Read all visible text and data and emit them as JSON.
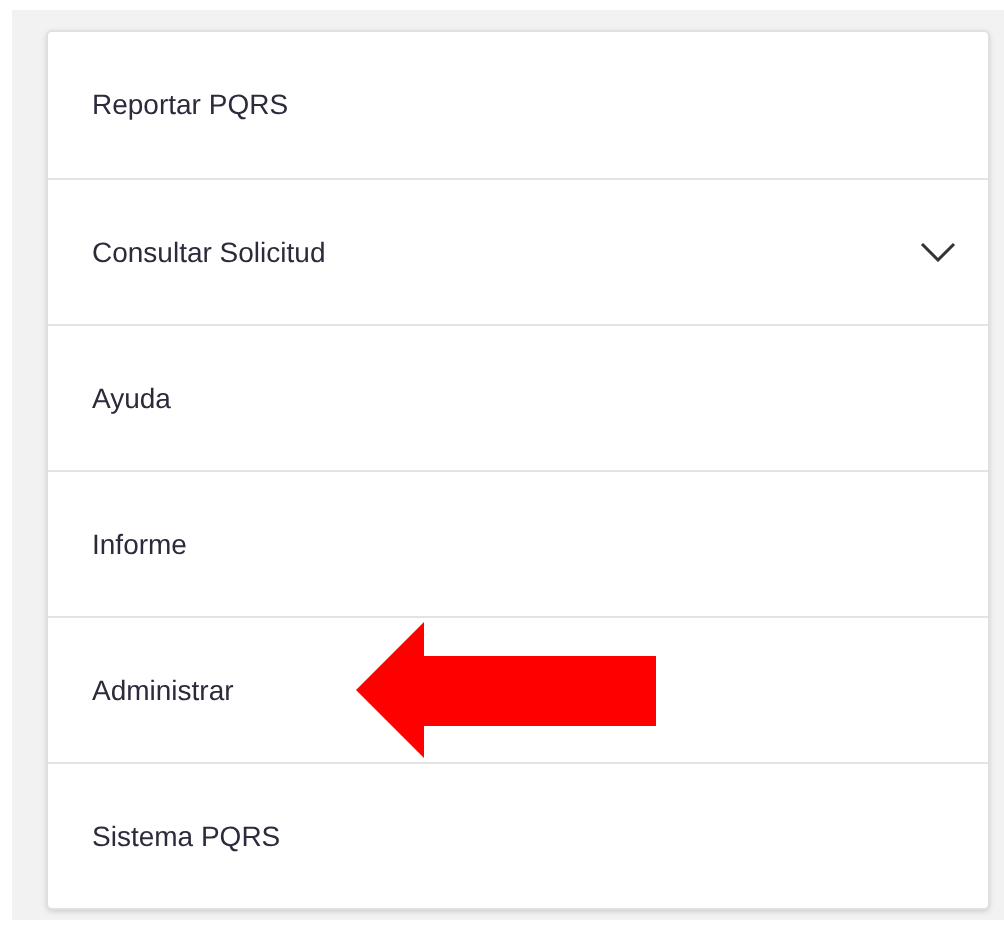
{
  "menu": {
    "items": [
      {
        "label": "Reportar PQRS",
        "kind": "link",
        "pointed": false
      },
      {
        "label": "Consultar Solicitud",
        "kind": "dropdown",
        "expanded": false,
        "pointed": false
      },
      {
        "label": "Ayuda",
        "kind": "link",
        "pointed": false
      },
      {
        "label": "Informe",
        "kind": "link",
        "pointed": false
      },
      {
        "label": "Administrar",
        "kind": "link",
        "pointed": true
      },
      {
        "label": "Sistema PQRS",
        "kind": "link",
        "pointed": false
      }
    ]
  }
}
